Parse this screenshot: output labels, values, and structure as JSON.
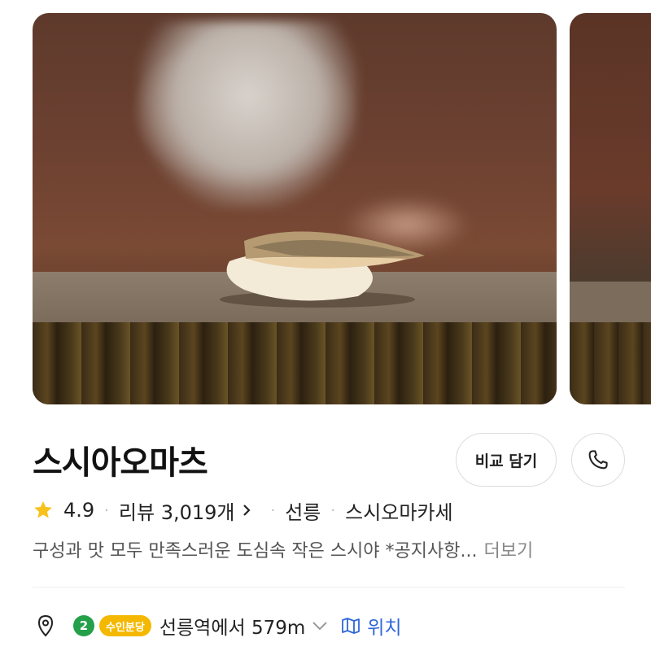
{
  "store": {
    "name": "스시아오마츠",
    "compare_label": "비교 담기",
    "rating": "4.9",
    "review_label": "리뷰 3,019개",
    "tags": [
      "선릉",
      "스시오마카세"
    ],
    "description": "구성과 맛 모두 만족스러운 도심속 작은 스시야  *공지사항...",
    "more_label": "더보기"
  },
  "location": {
    "line_number": "2",
    "line_badge": "수인분당",
    "distance": "선릉역에서 579m",
    "map_label": "위치"
  },
  "icons": {
    "rating": "star-icon",
    "phone": "phone-icon",
    "location": "pin-icon",
    "map": "map-icon"
  },
  "colors": {
    "star": "#f7c21b",
    "line2": "#24a04a",
    "suin_bundang": "#f5b800",
    "link": "#2f66d8"
  }
}
